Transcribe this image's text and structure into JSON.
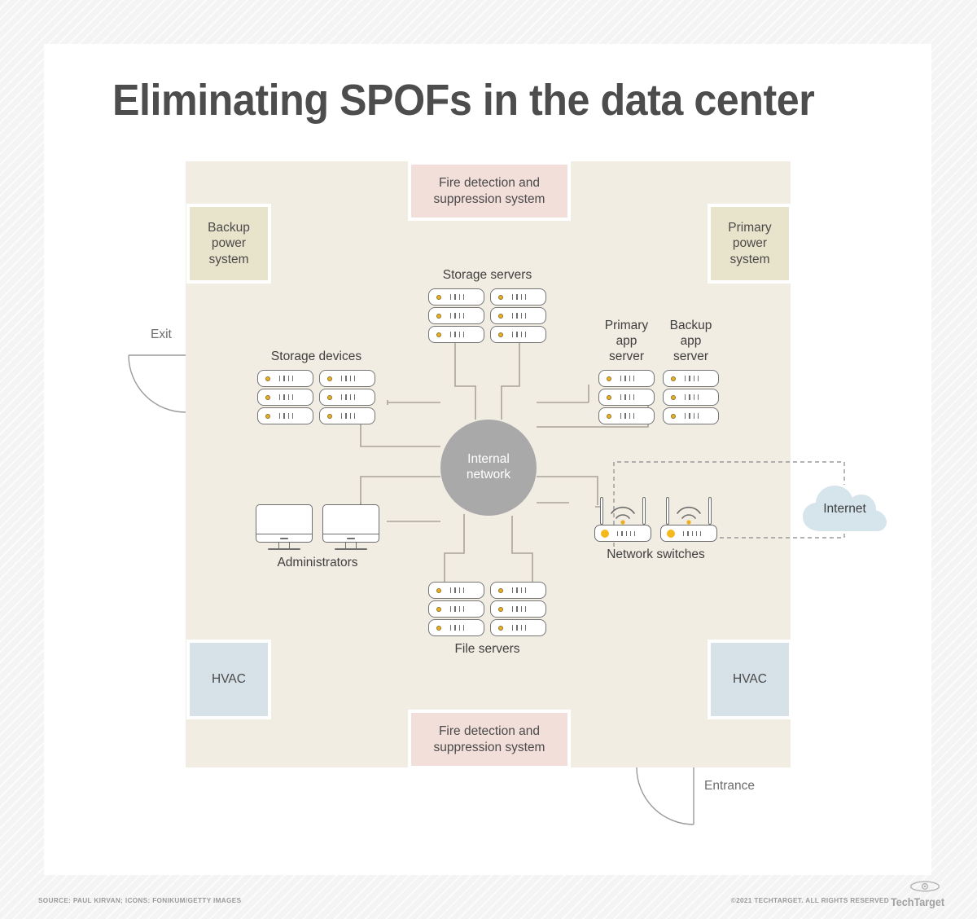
{
  "title": "Eliminating SPOFs in the data center",
  "hub": {
    "label": "Internal\nnetwork",
    "line1": "Internal",
    "line2": "network",
    "color": "#a9a9a9"
  },
  "facility_boxes": [
    {
      "id": "backup-power",
      "label": "Backup\npower\nsystem",
      "lines": [
        "Backup",
        "power",
        "system"
      ],
      "color": "#e8e3cb",
      "position": "top-left"
    },
    {
      "id": "primary-power",
      "label": "Primary\npower\nsystem",
      "lines": [
        "Primary",
        "power",
        "system"
      ],
      "color": "#e8e3cb",
      "position": "top-right"
    },
    {
      "id": "fire-top",
      "label": "Fire detection and suppression system",
      "lines": [
        "Fire detection and",
        "suppression system"
      ],
      "color": "#f3dfda",
      "position": "top-center"
    },
    {
      "id": "fire-bottom",
      "label": "Fire detection and suppression system",
      "lines": [
        "Fire detection and",
        "suppression system"
      ],
      "color": "#f3dfda",
      "position": "bottom-center"
    },
    {
      "id": "hvac-left",
      "label": "HVAC",
      "lines": [
        "HVAC"
      ],
      "color": "#d6e2e8",
      "position": "bottom-left"
    },
    {
      "id": "hvac-right",
      "label": "HVAC",
      "lines": [
        "HVAC"
      ],
      "color": "#d6e2e8",
      "position": "bottom-right"
    }
  ],
  "nodes": {
    "storage_servers": {
      "label": "Storage servers",
      "icon": "server-rack-icon",
      "count": 2,
      "units_per_rack": 3,
      "label_position": "above"
    },
    "storage_devices": {
      "label": "Storage devices",
      "icon": "server-rack-icon",
      "count": 2,
      "units_per_rack": 3,
      "label_position": "above"
    },
    "primary_app_server": {
      "label": "Primary\napp\nserver",
      "lines": [
        "Primary",
        "app",
        "server"
      ],
      "icon": "server-rack-icon",
      "units_per_rack": 3,
      "label_position": "above"
    },
    "backup_app_server": {
      "label": "Backup\napp\nserver",
      "lines": [
        "Backup",
        "app",
        "server"
      ],
      "icon": "server-rack-icon",
      "units_per_rack": 3,
      "label_position": "above"
    },
    "file_servers": {
      "label": "File servers",
      "icon": "server-rack-icon",
      "count": 2,
      "units_per_rack": 3,
      "label_position": "below"
    },
    "administrators": {
      "label": "Administrators",
      "icon": "monitor-icon",
      "count": 2,
      "label_position": "below"
    },
    "network_switches": {
      "label": "Network switches",
      "icon": "router-icon",
      "count": 2,
      "label_position": "below"
    },
    "internet": {
      "label": "Internet",
      "icon": "cloud-icon",
      "color": "#d6e4ec"
    }
  },
  "doors": {
    "exit": "Exit",
    "entrance": "Entrance"
  },
  "footer": {
    "source": "SOURCE: PAUL KIRVAN; ICONS: FONIKUM/GETTY IMAGES",
    "copyright": "©2021 TECHTARGET. ALL RIGHTS RESERVED",
    "brand": "TechTarget"
  },
  "colors": {
    "room_background": "#f2ede2",
    "page_background": "#f4f4f4",
    "card_background": "#ffffff",
    "title": "#4d4d4d",
    "connector": "#a9a39a",
    "led": "#f0ad1f",
    "outline": "#6e6e6e"
  }
}
